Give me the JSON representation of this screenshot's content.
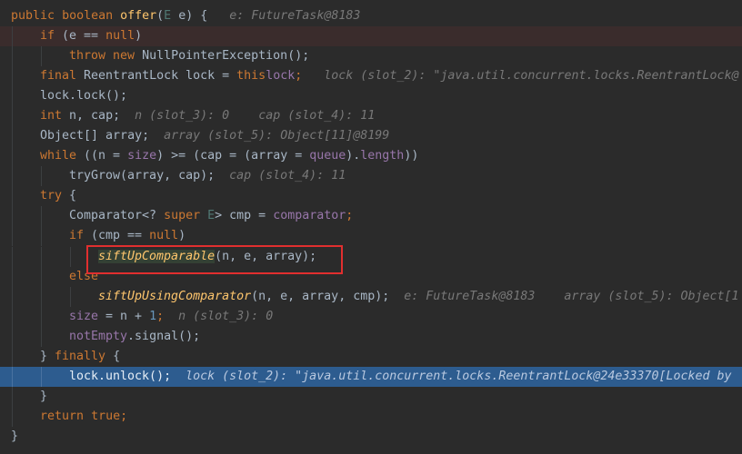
{
  "code": {
    "l1": {
      "kw1": "public",
      "kw2": "boolean",
      "fn": "offer",
      "p1": "(",
      "typ": "E",
      "p2": " e) {",
      "hint": "e: FutureTask@8183"
    },
    "l2": {
      "kw": "if",
      "rest": " (e == ",
      "kw2": "null",
      ")": ")"
    },
    "l3": {
      "kw1": "throw",
      "kw2": "new",
      "rest": " NullPointerException();"
    },
    "l4": {
      "kw": "final",
      "rest": " ReentrantLock lock = ",
      "this": "this",
      ".": ".",
      "fld": "lock",
      ";": ";",
      "hint": "lock (slot_2): \"java.util.concurrent.locks.ReentrantLock@"
    },
    "l5": {
      "text": "lock.lock();"
    },
    "l6": {
      "kw": "int",
      "rest": " n, cap;",
      "hint1": "n (slot_3): 0",
      "hint2": "cap (slot_4): 11"
    },
    "l7": {
      "text": "Object[] array;",
      "hint": "array (slot_5): Object[11]@8199"
    },
    "l8": {
      "kw": "while",
      "p1": " ((n = ",
      "fld": "size",
      "p2": ") >= (cap = (array = ",
      "fld2": "queue",
      "p3": ").",
      "fld3": "length",
      "p4": "))"
    },
    "l9": {
      "text": "tryGrow(array, cap);",
      "hint": "cap (slot_4): 11"
    },
    "l10": {
      "kw": "try",
      "rest": " {"
    },
    "l11": {
      "p1": "Comparator<? ",
      "kw": "super",
      "sp": " ",
      "typ": "E",
      "p2": "> cmp = ",
      "fld": "comparator",
      ";": ";"
    },
    "l12": {
      "kw": "if",
      "p1": " (cmp == ",
      "kw2": "null",
      ")": ")"
    },
    "l13": {
      "fn": "siftUpComparable",
      "rest": "(n, e, array);"
    },
    "l14": {
      "kw": "else"
    },
    "l15": {
      "fn": "siftUpUsingComparator",
      "rest": "(n, e, array, cmp);",
      "hint1": "e: FutureTask@8183",
      "hint2": "array (slot_5): Object[1"
    },
    "l16": {
      "fld": "size",
      "p1": " = n + ",
      "num": "1",
      ";": ";",
      "hint": "n (slot_3): 0"
    },
    "l17": {
      "fld": "notEmpty",
      "rest": ".signal();"
    },
    "l18": {
      "p1": "} ",
      "kw": "finally",
      "p2": " {"
    },
    "l19": {
      "text": "lock.unlock();",
      "hint": "lock (slot_2): \"java.util.concurrent.locks.ReentrantLock@24e33370[Locked by"
    },
    "l20": {
      "text": "}"
    },
    "l21": {
      "kw": "return",
      "sp": " ",
      "kw2": "true",
      ";": ";"
    },
    "l22": {
      "text": "}"
    }
  },
  "colors": {
    "background": "#2b2b2b",
    "keyword": "#cc7832",
    "method": "#ffc66d",
    "field": "#9876aa",
    "hint": "#787878",
    "execution_line": "#2d5c8f",
    "breakpoint_line": "#3a2c2c",
    "annotation_box": "#e12f2f"
  }
}
